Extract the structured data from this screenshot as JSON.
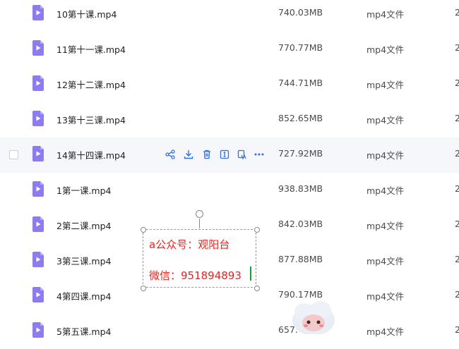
{
  "files": [
    {
      "name": "10第十课.mp4",
      "size": "740.03MB",
      "type": "mp4文件",
      "date": "2"
    },
    {
      "name": "11第十一课.mp4",
      "size": "770.77MB",
      "type": "mp4文件",
      "date": "2"
    },
    {
      "name": "12第十二课.mp4",
      "size": "744.71MB",
      "type": "mp4文件",
      "date": "2"
    },
    {
      "name": "13第十三课.mp4",
      "size": "852.65MB",
      "type": "mp4文件",
      "date": "2"
    },
    {
      "name": "14第十四课.mp4",
      "size": "727.92MB",
      "type": "mp4文件",
      "date": "2"
    },
    {
      "name": "1第一课.mp4",
      "size": "938.83MB",
      "type": "mp4文件",
      "date": "2"
    },
    {
      "name": "2第二课.mp4",
      "size": "842.03MB",
      "type": "mp4文件",
      "date": "2"
    },
    {
      "name": "3第三课.mp4",
      "size": "877.88MB",
      "type": "mp4文件",
      "date": "2"
    },
    {
      "name": "4第四课.mp4",
      "size": "790.17MB",
      "type": "mp4文件",
      "date": "2"
    },
    {
      "name": "5第五课.mp4",
      "size": "657.",
      "type": "mp4文件",
      "date": "2"
    }
  ],
  "hovered_row_actions": [
    "share-icon",
    "download-icon",
    "delete-icon",
    "rename-icon",
    "copy-icon",
    "more-icon"
  ],
  "annotation": {
    "line1": "a公众号：观阳台",
    "line2": "微信：951894893"
  },
  "colors": {
    "file_icon": "#8c7cf0",
    "action_icon": "#2f6fe6",
    "annotation_text": "#e8231f",
    "hover_row": "#f5f7fb"
  }
}
